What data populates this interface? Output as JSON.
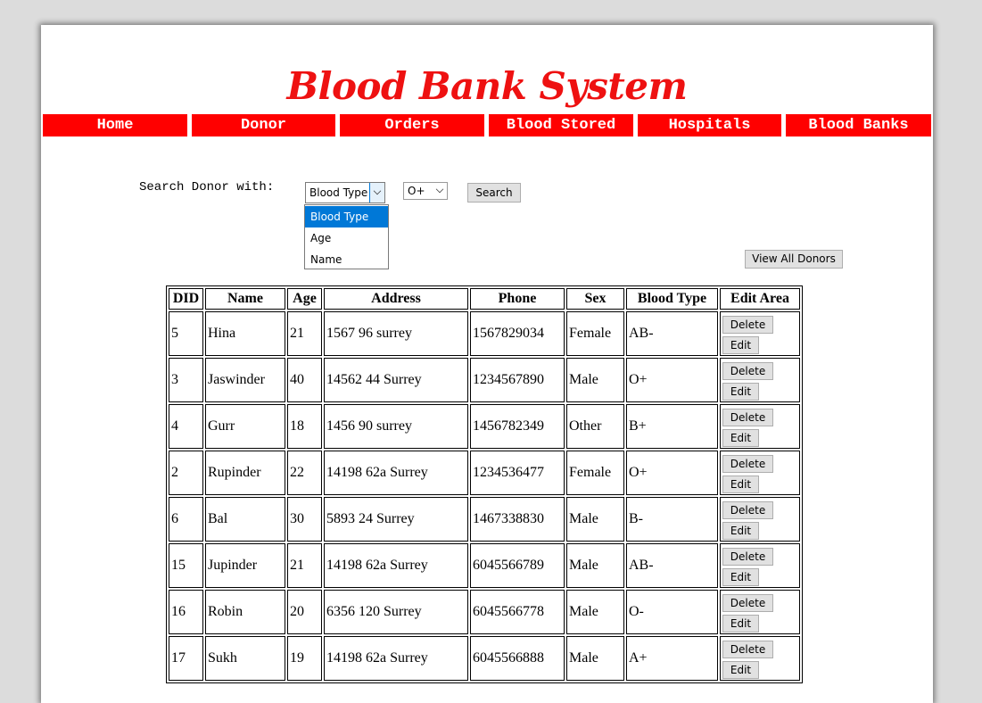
{
  "header": {
    "title": "Blood Bank System"
  },
  "nav": [
    "Home",
    "Donor",
    "Orders",
    "Blood Stored",
    "Hospitals",
    "Blood Banks"
  ],
  "search": {
    "label": "Search Donor with:",
    "field_select": {
      "value": "Blood Type",
      "options": [
        "Blood Type",
        "Age",
        "Name"
      ],
      "highlighted": "Blood Type"
    },
    "blood_select": {
      "value": "O+"
    },
    "search_button": "Search"
  },
  "view_all_button": "View All Donors",
  "table": {
    "headers": [
      "DID",
      "Name",
      "Age",
      "Address",
      "Phone",
      "Sex",
      "Blood Type",
      "Edit Area"
    ],
    "delete_label": "Delete",
    "edit_label": "Edit",
    "rows": [
      [
        "5",
        "Hina",
        "21",
        "1567 96 surrey",
        "1567829034",
        "Female",
        "AB-"
      ],
      [
        "3",
        "Jaswinder",
        "40",
        "14562 44 Surrey",
        "1234567890",
        "Male",
        "O+"
      ],
      [
        "4",
        "Gurr",
        "18",
        "1456 90 surrey",
        "1456782349",
        "Other",
        "B+"
      ],
      [
        "2",
        "Rupinder",
        "22",
        "14198 62a Surrey",
        "1234536477",
        "Female",
        "O+"
      ],
      [
        "6",
        "Bal",
        "30",
        "5893 24 Surrey",
        "1467338830",
        "Male",
        "B-"
      ],
      [
        "15",
        "Jupinder",
        "21",
        "14198 62a Surrey",
        "6045566789",
        "Male",
        "AB-"
      ],
      [
        "16",
        "Robin",
        "20",
        "6356 120 Surrey",
        "6045566778",
        "Male",
        "O-"
      ],
      [
        "17",
        "Sukh",
        "19",
        "14198 62a Surrey",
        "6045566888",
        "Male",
        "A+"
      ]
    ]
  },
  "colors": {
    "brand": "#ff0000",
    "title": "#ee1111",
    "highlight": "#0078d7",
    "button": "#e1e1e1"
  }
}
